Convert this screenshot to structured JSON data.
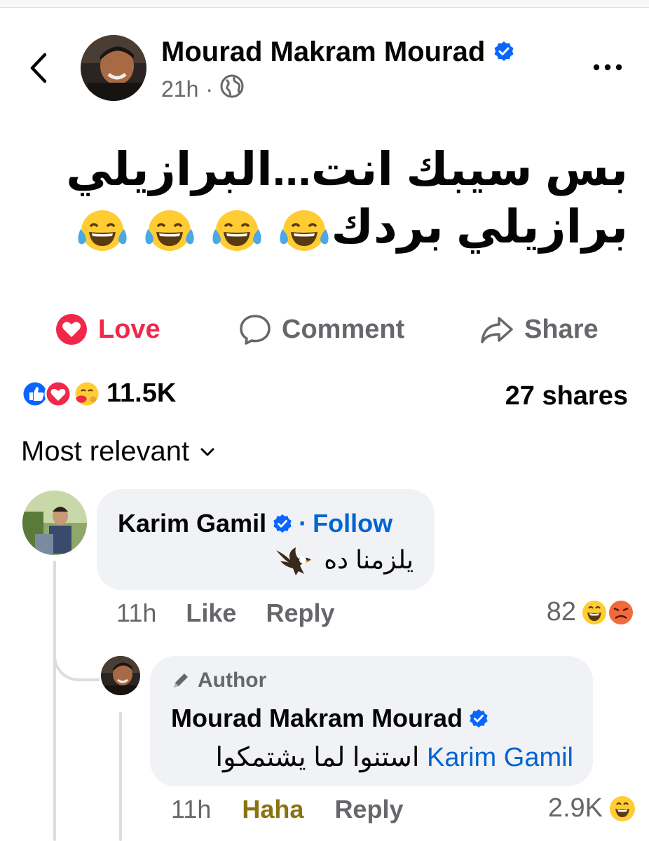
{
  "post": {
    "author": "Mourad Makram Mourad",
    "time": "21h",
    "separator": "·",
    "text_line1": "بس سيبك انت...البرازيلي",
    "text_line2": "برازيلي بردك",
    "emoji_name": "face-with-tears-of-joy",
    "emoji_count": 4
  },
  "actions": {
    "love": "Love",
    "comment": "Comment",
    "share": "Share"
  },
  "stats": {
    "reactions": "11.5K",
    "shares": "27 shares"
  },
  "sort": {
    "label": "Most relevant"
  },
  "comments": [
    {
      "author": "Karim Gamil",
      "follow_sep": "·",
      "follow": "Follow",
      "text": "يلزمنا ده",
      "time": "11h",
      "like": "Like",
      "reply": "Reply",
      "reaction_count": "82"
    },
    {
      "badge": "Author",
      "author": "Mourad Makram Mourad",
      "mention": "Karim Gamil",
      "text": "استنوا لما يشتمكوا",
      "time": "11h",
      "like": "Haha",
      "reply": "Reply",
      "reaction_count": "2.9K"
    }
  ],
  "colors": {
    "brand_blue": "#0866ff",
    "love_red": "#f0284a",
    "link_blue": "#0064d1",
    "haha_gold": "#8a7410",
    "secondary_text": "#65676b",
    "bubble_bg": "#f0f2f5"
  }
}
